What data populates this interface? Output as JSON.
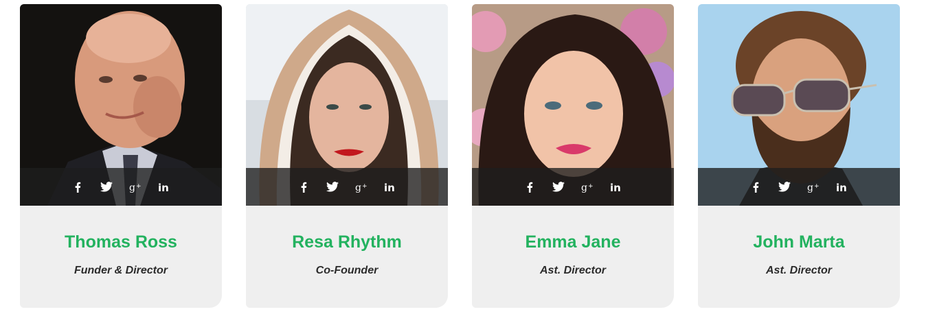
{
  "team": {
    "members": [
      {
        "name": "Thomas Ross",
        "role": "Funder & Director"
      },
      {
        "name": "Resa Rhythm",
        "role": "Co-Founder"
      },
      {
        "name": "Emma Jane",
        "role": "Ast. Director"
      },
      {
        "name": "John Marta",
        "role": "Ast. Director"
      }
    ],
    "social_icons": [
      "facebook-icon",
      "twitter-icon",
      "google-plus-icon",
      "linkedin-icon"
    ]
  },
  "colors": {
    "name_green": "#23b25f",
    "card_bg": "#efefef",
    "social_bar": "#1e1e1e"
  }
}
